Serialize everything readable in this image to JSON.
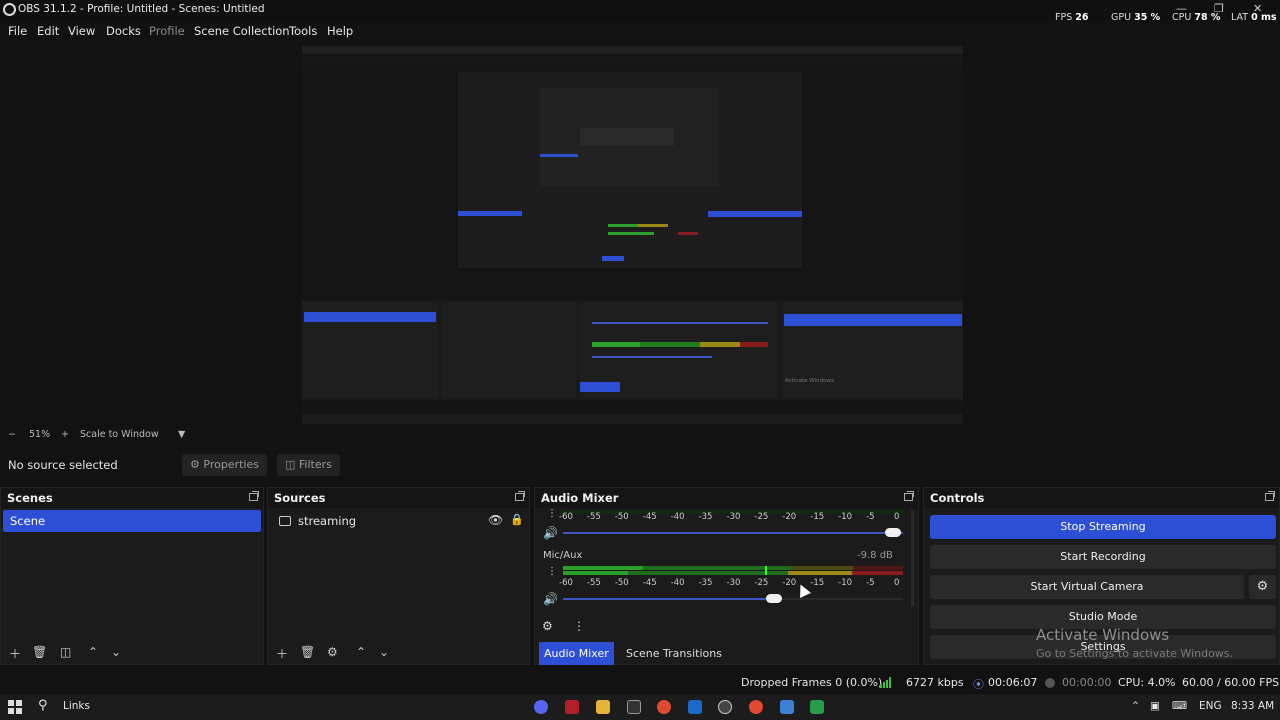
{
  "window": {
    "title": "OBS 31.1.2 - Profile: Untitled - Scenes: Untitled",
    "stats": {
      "fps_label": "FPS",
      "fps_value": "26",
      "gpu_label": "GPU",
      "gpu_value": "35 %",
      "cpu_label": "CPU",
      "cpu_value": "78 %",
      "lat_label": "LAT",
      "lat_value": "0 ms"
    }
  },
  "menu": [
    "File",
    "Edit",
    "View",
    "Docks",
    "Profile",
    "Scene Collection",
    "Tools",
    "Help"
  ],
  "zoom": {
    "minus": "−",
    "value": "51%",
    "plus": "+",
    "mode": "Scale to Window"
  },
  "context": {
    "selection": "No source selected",
    "properties": "Properties",
    "filters": "Filters"
  },
  "scenes": {
    "title": "Scenes",
    "items": [
      "Scene"
    ]
  },
  "sources": {
    "title": "Sources",
    "items": [
      "streaming"
    ]
  },
  "mixer": {
    "title": "Audio Mixer",
    "scale": [
      "-60",
      "-55",
      "-50",
      "-45",
      "-40",
      "-35",
      "-30",
      "-25",
      "-20",
      "-15",
      "-10",
      "-5",
      "0"
    ],
    "channels": [
      {
        "name": "",
        "db": "",
        "volume": 0.97
      },
      {
        "name": "Mic/Aux",
        "db": "-9.8 dB",
        "volume": 0.62
      }
    ],
    "tabs": {
      "active": "Audio Mixer",
      "other": "Scene Transitions"
    }
  },
  "controls": {
    "title": "Controls",
    "stop_streaming": "Stop Streaming",
    "start_recording": "Start Recording",
    "start_virtual_camera": "Start Virtual Camera",
    "studio_mode": "Studio Mode",
    "settings": "Settings"
  },
  "watermark": {
    "line1": "Activate Windows",
    "line2": "Go to Settings to activate Windows."
  },
  "status": {
    "dropped": "Dropped Frames 0 (0.0%)",
    "bitrate": "6727 kbps",
    "stream_time": "00:06:07",
    "record_time": "00:00:00",
    "cpu": "CPU: 4.0%",
    "fps": "60.00 / 60.00 FPS"
  },
  "taskbar": {
    "search_label": "Links",
    "lang": "ENG",
    "time": "8:33 AM"
  },
  "colors": {
    "accent": "#2d4fd6",
    "meter_green": "#2aa02a",
    "meter_yellow": "#9c8a18",
    "meter_red": "#8c1b1b",
    "status_green": "#3fbf3f"
  }
}
